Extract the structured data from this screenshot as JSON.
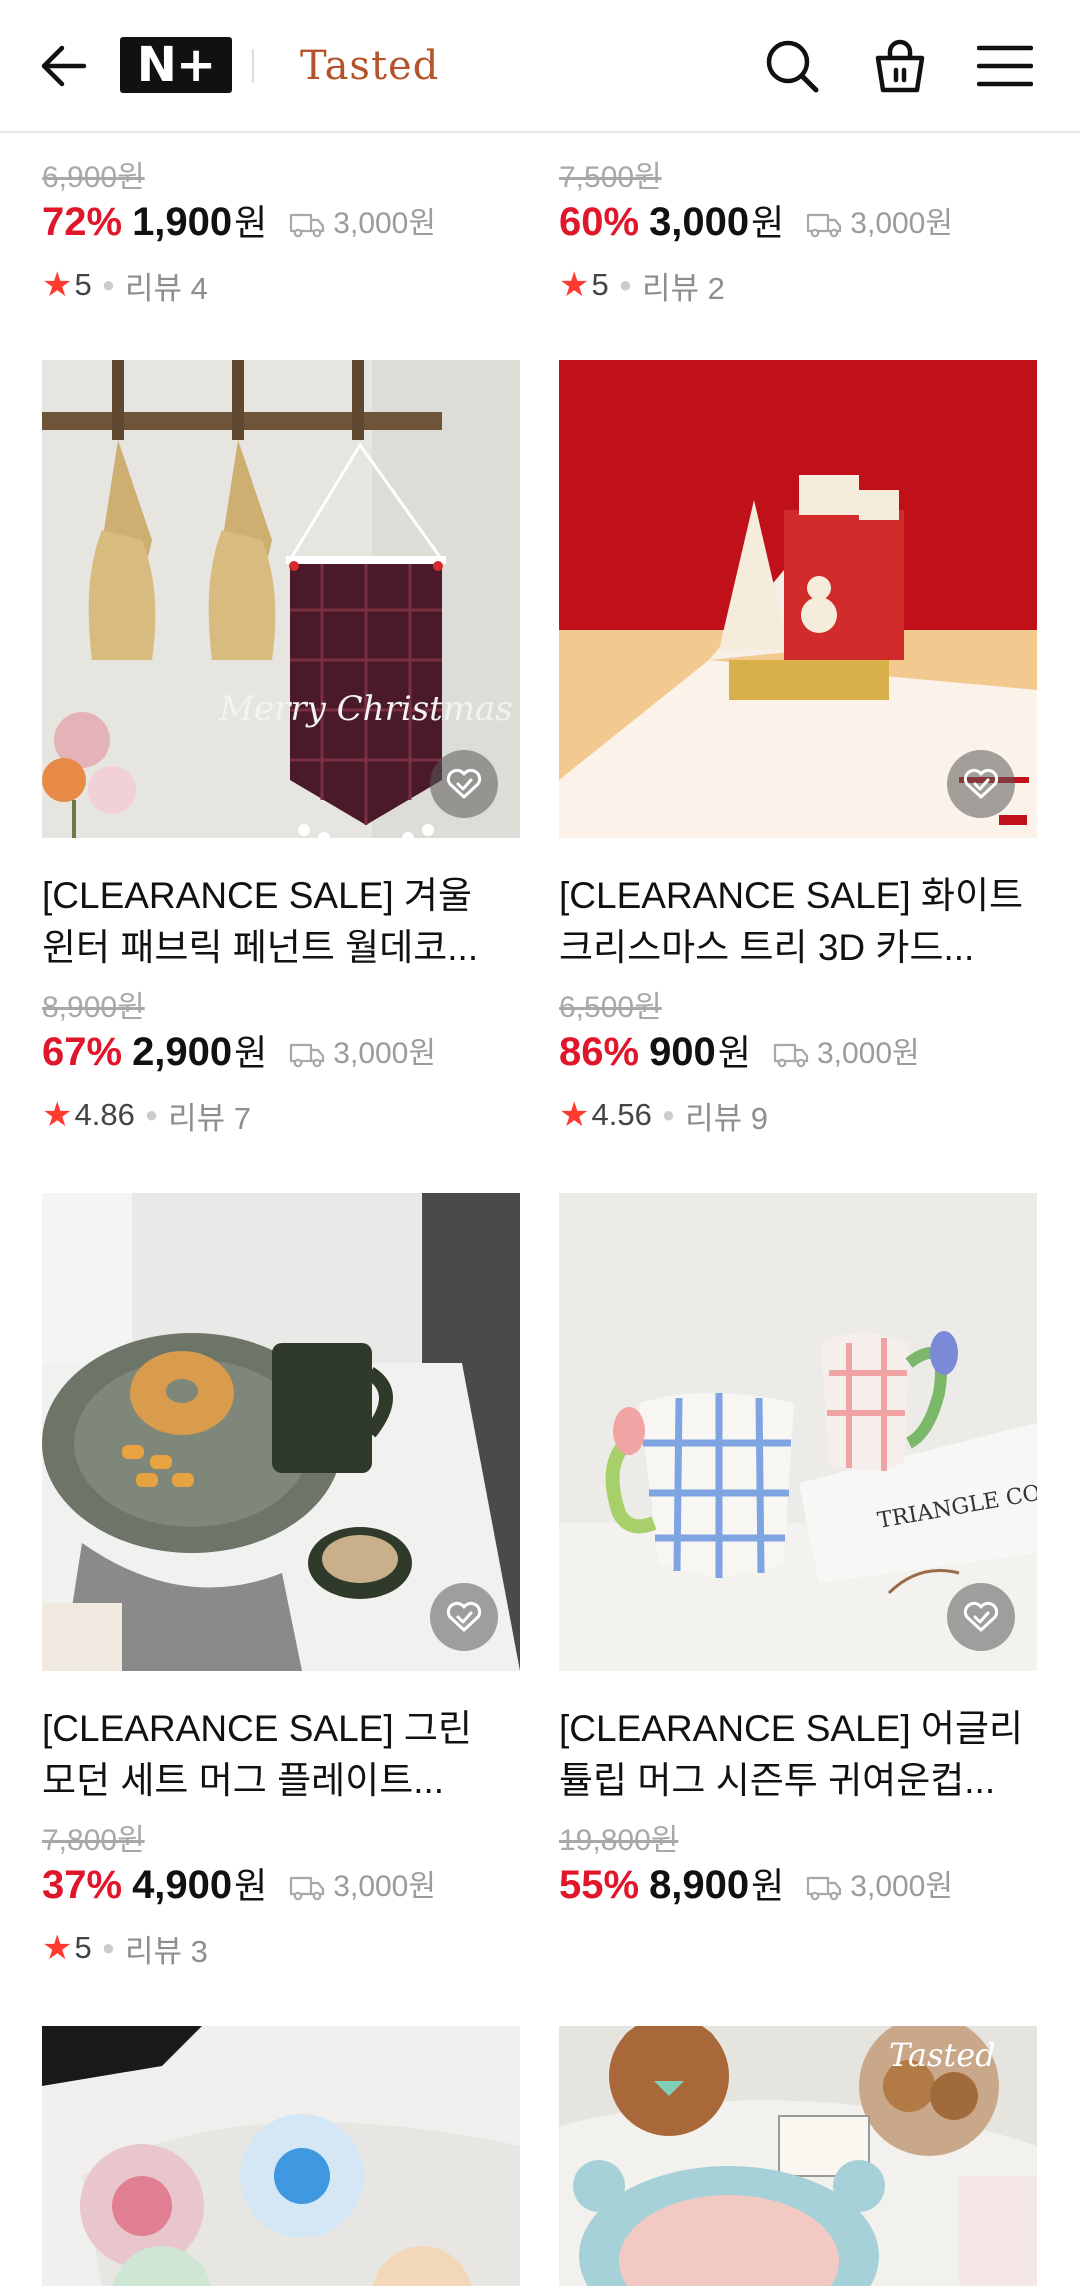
{
  "header": {
    "back_icon": "arrow-left-icon",
    "badge_label": "N+",
    "brand_name": "Tasted",
    "search_icon": "search-icon",
    "bag_icon": "shopping-bag-icon",
    "menu_icon": "hamburger-menu-icon"
  },
  "colors": {
    "discount_red": "#e0162b",
    "star_red": "#ff3b30",
    "brand_brown": "#b5532a",
    "muted_gray": "#a8a8a8"
  },
  "products": [
    {
      "title_line1": "",
      "title_line2": "",
      "original_price": "6,900원",
      "discount": "72%",
      "price": "1,900",
      "currency": "원",
      "shipping": "3,000원",
      "rating": "5",
      "reviews": "리뷰 4"
    },
    {
      "title_line1": "",
      "title_line2": "",
      "original_price": "7,500원",
      "discount": "60%",
      "price": "3,000",
      "currency": "원",
      "shipping": "3,000원",
      "rating": "5",
      "reviews": "리뷰 2"
    },
    {
      "title_line1": "[CLEARANCE SALE] 겨울",
      "title_line2": "윈터 패브릭 페넌트 월데코...",
      "original_price": "8,900원",
      "discount": "67%",
      "price": "2,900",
      "currency": "원",
      "shipping": "3,000원",
      "rating": "4.86",
      "reviews": "리뷰 7"
    },
    {
      "title_line1": "[CLEARANCE SALE] 화이트",
      "title_line2": "크리스마스 트리 3D 카드...",
      "original_price": "6,500원",
      "discount": "86%",
      "price": "900",
      "currency": "원",
      "shipping": "3,000원",
      "rating": "4.56",
      "reviews": "리뷰 9"
    },
    {
      "title_line1": "[CLEARANCE SALE] 그린",
      "title_line2": "모던 세트 머그 플레이트...",
      "original_price": "7,800원",
      "discount": "37%",
      "price": "4,900",
      "currency": "원",
      "shipping": "3,000원",
      "rating": "5",
      "reviews": "리뷰 3"
    },
    {
      "title_line1": "[CLEARANCE SALE] 어글리",
      "title_line2": "튤립 머그 시즌투 귀여운컵...",
      "original_price": "19,800원",
      "discount": "55%",
      "price": "8,900",
      "currency": "원",
      "shipping": "3,000원",
      "rating": "",
      "reviews": ""
    }
  ],
  "image_texts": {
    "banner_text": "Merry Christmas",
    "book_text": "TRIANGLE CONSTR",
    "watermark": "Tasted"
  }
}
